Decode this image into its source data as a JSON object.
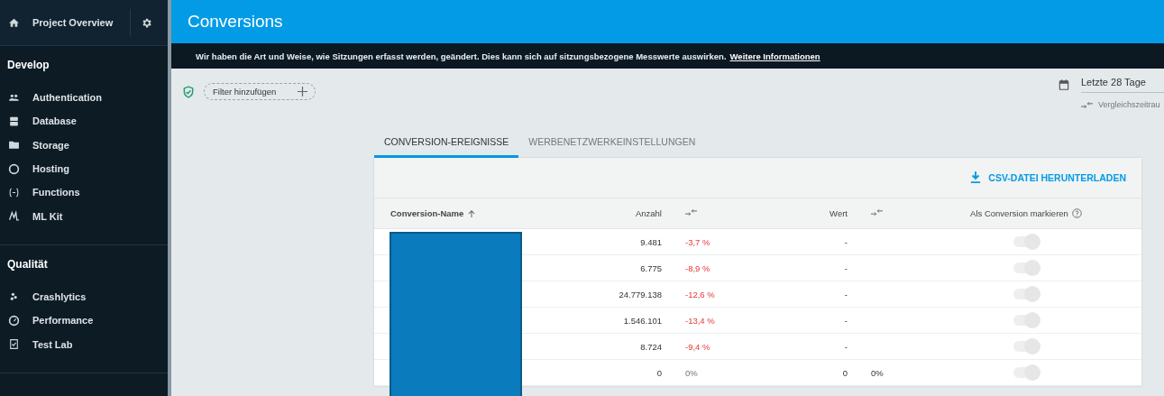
{
  "sidebar": {
    "project": "Project Overview",
    "sections": [
      {
        "title": "Develop",
        "items": [
          "Authentication",
          "Database",
          "Storage",
          "Hosting",
          "Functions",
          "ML Kit"
        ]
      },
      {
        "title": "Qualität",
        "items": [
          "Crashlytics",
          "Performance",
          "Test Lab"
        ]
      }
    ]
  },
  "header": {
    "title": "Conversions"
  },
  "banner": {
    "text": "Wir haben die Art und Weise, wie Sitzungen erfasst werden, geändert. Dies kann sich auf sitzungsbezogene Messwerte auswirken.",
    "link": "Weitere Informationen"
  },
  "filter": {
    "label": "Filter hinzufügen"
  },
  "date_range": {
    "value": "Letzte 28 Tage",
    "compare": "Vergleichszeitrau"
  },
  "tabs": [
    {
      "label": "CONVERSION-EREIGNISSE",
      "selected": true
    },
    {
      "label": "WERBENETZWERKEINSTELLUNGEN",
      "selected": false
    }
  ],
  "download": "CSV-DATEI HERUNTERLADEN",
  "table": {
    "columns": {
      "name": "Conversion-Name",
      "count": "Anzahl",
      "value": "Wert",
      "mark": "Als Conversion markieren"
    },
    "rows": [
      {
        "count": "9.481",
        "count_change": "-3,7 %",
        "negative": true,
        "value": "-",
        "on": true,
        "disabled": true
      },
      {
        "count": "6.775",
        "count_change": "-8,9 %",
        "negative": true,
        "value": "-",
        "on": true,
        "disabled": true
      },
      {
        "count": "24.779.138",
        "count_change": "-12,6 %",
        "negative": true,
        "value": "-",
        "on": true,
        "disabled": true
      },
      {
        "count": "1.546.101",
        "count_change": "-13,4 %",
        "negative": true,
        "value": "-",
        "on": true,
        "disabled": true
      },
      {
        "count": "8.724",
        "count_change": "-9,4 %",
        "negative": true,
        "value": "-",
        "on": true,
        "disabled": true
      },
      {
        "count": "0",
        "count_change": "0%",
        "negative": false,
        "value": "0",
        "value_change": "0%",
        "on": true,
        "disabled": true
      }
    ]
  }
}
